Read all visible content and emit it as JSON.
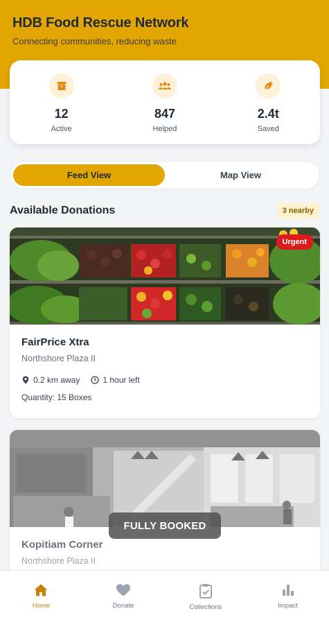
{
  "header": {
    "title": "HDB Food Rescue Network",
    "subtitle": "Connecting communities, reducing waste"
  },
  "stats": [
    {
      "icon": "box-icon",
      "value": "12",
      "label": "Active"
    },
    {
      "icon": "users-icon",
      "value": "847",
      "label": "Helped"
    },
    {
      "icon": "leaf-icon",
      "value": "2.4t",
      "label": "Saved"
    }
  ],
  "view_toggle": {
    "feed_label": "Feed View",
    "map_label": "Map View",
    "selected": "Feed View"
  },
  "section": {
    "title": "Available Donations",
    "nearby_badge": "3 nearby"
  },
  "donations": [
    {
      "name": "FairPrice Xtra",
      "location": "Northshore Plaza II",
      "distance": "0.2 km away",
      "time_left": "1 hour left",
      "quantity": "Quantity: 15 Boxes",
      "badge": "Urgent",
      "image": "produce-shelves-photo"
    },
    {
      "name": "Kopitiam Corner",
      "location": "Northshore Plaza II",
      "status_overlay": "FULLY BOOKED",
      "image": "cafe-interior-photo"
    }
  ],
  "bottom_nav": [
    {
      "label": "Home",
      "icon": "home-icon",
      "active": true
    },
    {
      "label": "Donate",
      "icon": "heart-icon",
      "active": false
    },
    {
      "label": "Collections",
      "icon": "clipboard-check-icon",
      "active": false
    },
    {
      "label": "Impact",
      "icon": "bar-chart-icon",
      "active": false
    }
  ],
  "colors": {
    "brand": "#e3a600",
    "urgent": "#dc1c1c",
    "active_nav": "#c7820a"
  }
}
